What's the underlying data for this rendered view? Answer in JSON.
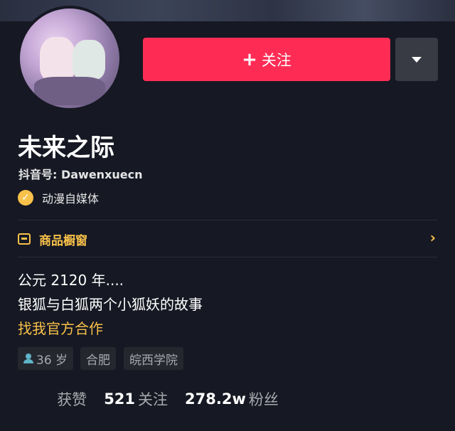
{
  "profile": {
    "name": "未来之际",
    "douyin_id": "抖音号: Dawenxuecn",
    "verification": "动漫自媒体",
    "shop_label": "商品橱窗",
    "bio_lines": [
      "公元 2120 年....",
      "银狐与白狐两个小狐妖的故事"
    ],
    "bio_link": "找我官方合作"
  },
  "actions": {
    "follow_plus": "+",
    "follow_label": "关注"
  },
  "tags": {
    "age": "36 岁",
    "city": "合肥",
    "school": "皖西学院"
  },
  "stats": {
    "likes_label": "获赞",
    "following_value": "521",
    "following_label": "关注",
    "followers_value": "278.2w",
    "followers_label": "粉丝"
  },
  "colors": {
    "background": "#161823",
    "accent": "#fe2c55",
    "highlight": "#f8c14a"
  }
}
